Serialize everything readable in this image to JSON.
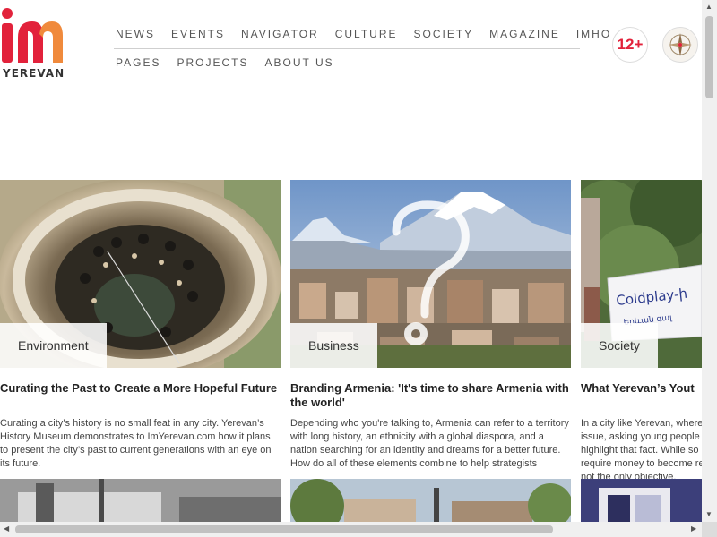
{
  "site": {
    "logo_text": "YEREVAN",
    "age_rating": "12+"
  },
  "nav": {
    "row1": [
      "NEWS",
      "EVENTS",
      "NAVIGATOR",
      "CULTURE",
      "SOCIETY",
      "MAGAZINE",
      "IMHO"
    ],
    "row2": [
      "PAGES",
      "PROJECTS",
      "ABOUT US"
    ]
  },
  "cards": [
    {
      "tag": "Environment",
      "title": "Curating the Past to Create a More Hopeful Future",
      "excerpt": "Curating a city’s history is no small feat in any city. Yerevan’s History Museum demonstrates to ImYerevan.com how it plans to present the city’s past to current generations with an eye on its future."
    },
    {
      "tag": "Business",
      "title": "Branding Armenia: 'It's time to share Armenia with the world'",
      "excerpt": "Depending who you're talking to, Armenia can refer to a territory with long history, an ethnicity with a global diaspora, and a nation searching for an identity and dreams for a better future. How do all of these elements combine to help strategists"
    },
    {
      "tag": "Society",
      "title": "What Yerevan’s Yout",
      "excerpt": "In a city like Yerevan, where issue, asking young people highlight that fact. While so require money to become re not the only objective.",
      "sign_text": "Coldplay-ի",
      "sign_text2": "Երևան գալ"
    }
  ],
  "colors": {
    "brand_red": "#e2223b",
    "nav_text": "#555555"
  }
}
